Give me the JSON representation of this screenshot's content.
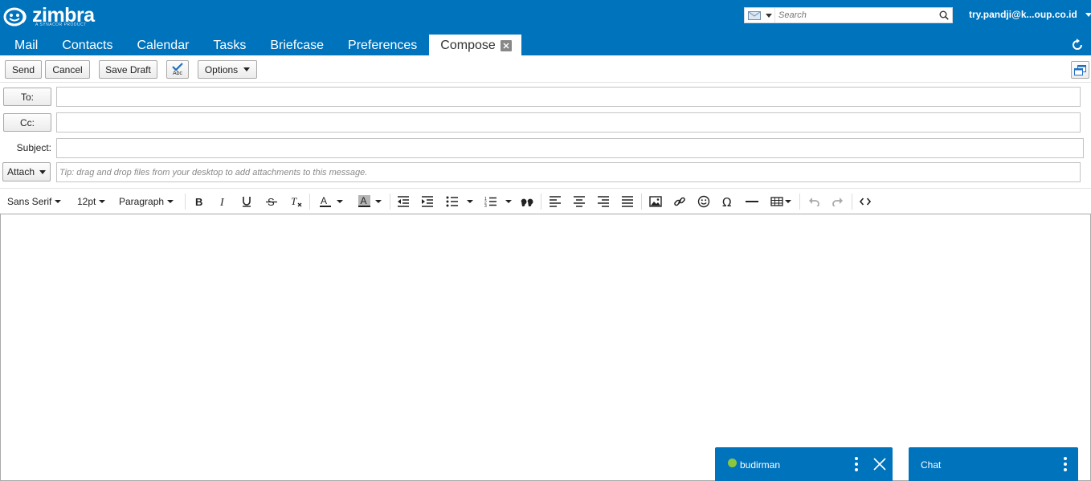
{
  "brand": {
    "name": "zimbra",
    "tagline": "A SYNACOR PRODUCT",
    "color": "#0073bd"
  },
  "search": {
    "placeholder": "Search",
    "type_icon": "mail-icon",
    "button_icon": "search-icon"
  },
  "user": {
    "display": "try.pandji@k...oup.co.id"
  },
  "tabs": [
    {
      "label": "Mail"
    },
    {
      "label": "Contacts"
    },
    {
      "label": "Calendar"
    },
    {
      "label": "Tasks"
    },
    {
      "label": "Briefcase"
    },
    {
      "label": "Preferences"
    },
    {
      "label": "Compose",
      "active": true
    }
  ],
  "toolbar": {
    "send": "Send",
    "cancel": "Cancel",
    "save_draft": "Save Draft",
    "spellcheck_label": "Abc",
    "options": "Options"
  },
  "fields": {
    "to_label": "To:",
    "cc_label": "Cc:",
    "subject_label": "Subject:",
    "to_value": "",
    "cc_value": "",
    "subject_value": "",
    "attach_label": "Attach",
    "attach_tip": "Tip: drag and drop files from your desktop to add attachments to this message."
  },
  "editor_toolbar": {
    "font_family": "Sans Serif",
    "font_size": "12pt",
    "block_format": "Paragraph"
  },
  "chats": [
    {
      "name": "budirman",
      "status": "online",
      "status_color": "#8bc63f"
    },
    {
      "name": "Chat"
    }
  ]
}
